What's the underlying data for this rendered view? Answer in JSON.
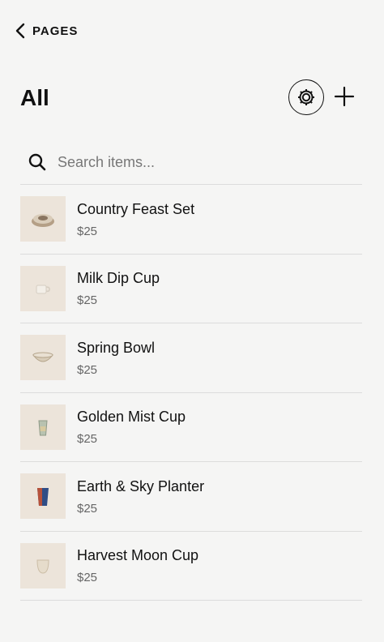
{
  "nav": {
    "back_label": "PAGES"
  },
  "header": {
    "title": "All"
  },
  "search": {
    "placeholder": "Search items..."
  },
  "items": [
    {
      "name": "Country Feast Set",
      "price": "$25",
      "thumb": "stacked-plates"
    },
    {
      "name": "Milk Dip Cup",
      "price": "$25",
      "thumb": "small-cup"
    },
    {
      "name": "Spring Bowl",
      "price": "$25",
      "thumb": "bowl"
    },
    {
      "name": "Golden Mist Cup",
      "price": "$25",
      "thumb": "tall-cup"
    },
    {
      "name": "Earth & Sky Planter",
      "price": "$25",
      "thumb": "planter"
    },
    {
      "name": "Harvest Moon Cup",
      "price": "$25",
      "thumb": "round-cup"
    }
  ]
}
